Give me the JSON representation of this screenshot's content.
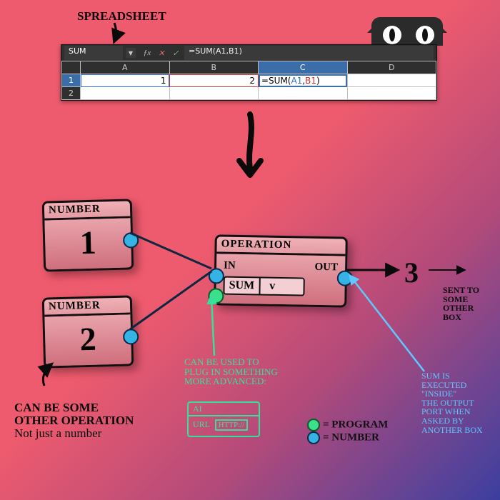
{
  "annotations": {
    "spreadsheet_label": "SPREADSHEET",
    "canbe_other_op_l1": "CAN BE SOME",
    "canbe_other_op_l2": "OTHER OPERATION",
    "canbe_other_op_l3": "Not just a number",
    "plugin_l1": "CAN BE USED TO",
    "plugin_l2": "PLUG IN SOMETHING",
    "plugin_l3": "MORE ADVANCED:",
    "sumexec_l1": "SUM IS",
    "sumexec_l2": "EXECUTED",
    "sumexec_l3": "\"INSIDE\"",
    "sumexec_l4": "THE OUTPUT",
    "sumexec_l5": "PORT WHEN",
    "sumexec_l6": "ASKED BY",
    "sumexec_l7": "ANOTHER BOX",
    "sent_l1": "SENT TO",
    "sent_l2": "SOME OTHER",
    "sent_l3": "BOX",
    "legend_program": "= PROGRAM",
    "legend_number": "= NUMBER"
  },
  "spreadsheet": {
    "namebox": "SUM",
    "formula_bar": "=SUM(A1,B1)",
    "columns": [
      "A",
      "B",
      "C",
      "D"
    ],
    "active_column": "C",
    "rows": [
      {
        "n": "1",
        "active": true,
        "A": "1",
        "B": "2",
        "C_prefix": "=SUM(",
        "C_ref1": "A1",
        "C_comma": ",",
        "C_ref2": "B1",
        "C_suffix": ")",
        "D": ""
      },
      {
        "n": "2",
        "active": false,
        "A": "",
        "B": "",
        "C": "",
        "D": ""
      }
    ]
  },
  "nodes": {
    "num1": {
      "title": "NUMBER",
      "value": "1"
    },
    "num2": {
      "title": "NUMBER",
      "value": "2"
    },
    "op": {
      "title": "OPERATION",
      "in_label": "IN",
      "out_label": "OUT",
      "dropdown_value": "SUM",
      "dropdown_caret": "v"
    }
  },
  "result_value": "3",
  "ai_box": {
    "header": "AI",
    "url_label": "URL",
    "url_value": "HTTP://"
  }
}
